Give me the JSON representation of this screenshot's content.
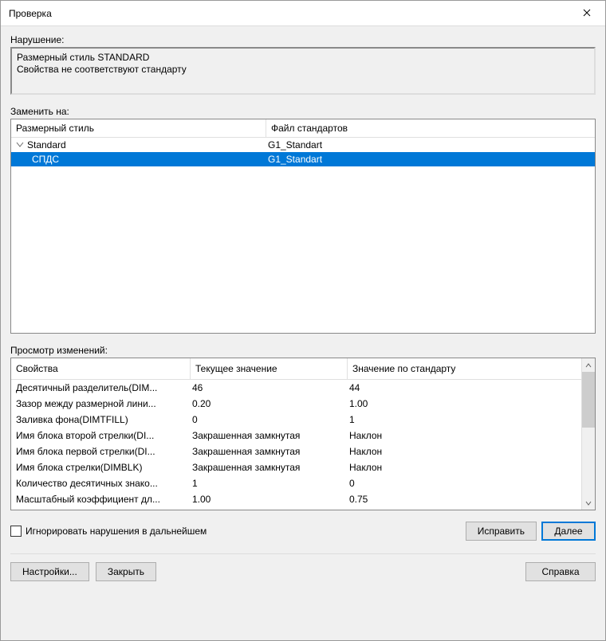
{
  "title": "Проверка",
  "violation": {
    "label": "Нарушение:",
    "line1": "Размерный стиль STANDARD",
    "line2": "Свойства не соответствуют стандарту"
  },
  "replace": {
    "label": "Заменить на:",
    "header_col1": "Размерный стиль",
    "header_col2": "Файл стандартов",
    "rows": [
      {
        "name": "Standard",
        "file": "G1_Standart",
        "selected": false,
        "indent": 0,
        "expander": true
      },
      {
        "name": "СПДС",
        "file": "G1_Standart",
        "selected": true,
        "indent": 1,
        "expander": false
      }
    ]
  },
  "preview": {
    "label": "Просмотр изменений:",
    "header_col1": "Свойства",
    "header_col2": "Текущее значение",
    "header_col3": "Значение по стандарту",
    "rows": [
      {
        "prop": "Десятичный разделитель(DIM...",
        "cur": "46",
        "std": "44"
      },
      {
        "prop": "Зазор между размерной лини...",
        "cur": "0.20",
        "std": "1.00"
      },
      {
        "prop": "Заливка фона(DIMTFILL)",
        "cur": "0",
        "std": "1"
      },
      {
        "prop": "Имя блока второй стрелки(DI...",
        "cur": "Закрашенная замкнутая",
        "std": "Наклон"
      },
      {
        "prop": "Имя блока первой стрелки(DI...",
        "cur": "Закрашенная замкнутая",
        "std": "Наклон"
      },
      {
        "prop": "Имя блока стрелки(DIMBLK)",
        "cur": "Закрашенная замкнутая",
        "std": "Наклон"
      },
      {
        "prop": "Количество десятичных знако...",
        "cur": "1",
        "std": "0"
      },
      {
        "prop": "Масштабный коэффициент дл...",
        "cur": "1.00",
        "std": "0.75"
      }
    ]
  },
  "ignore_label": "Игнорировать нарушения в дальнейшем",
  "buttons": {
    "fix": "Исправить",
    "next": "Далее",
    "settings": "Настройки...",
    "close": "Закрыть",
    "help": "Справка"
  }
}
